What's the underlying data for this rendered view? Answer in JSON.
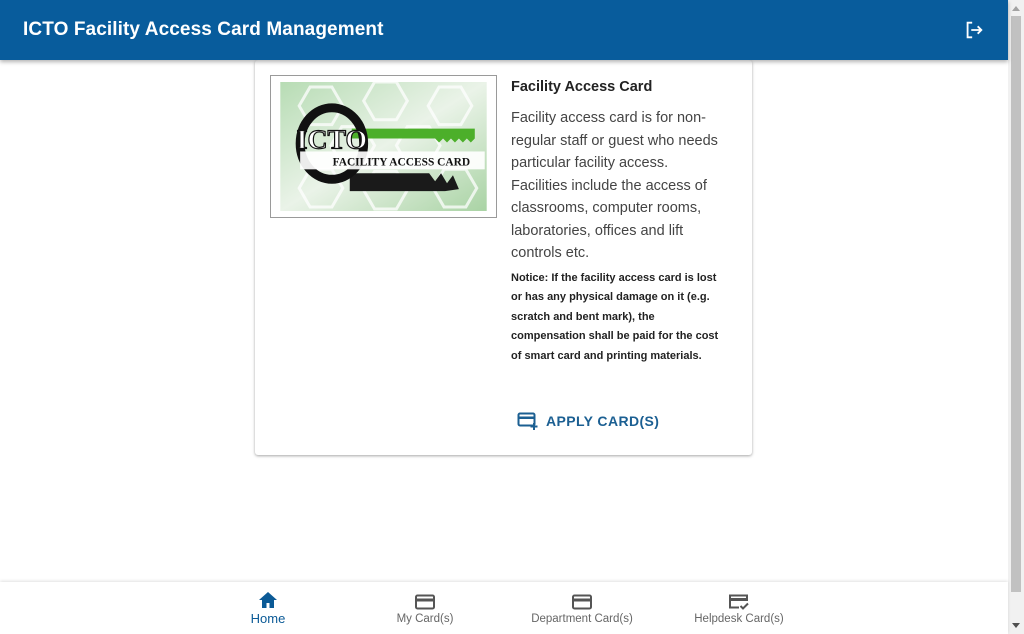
{
  "app": {
    "title": "ICTO Facility Access Card Management",
    "logout_icon": "logout-icon",
    "brand_color": "#085c9c"
  },
  "card": {
    "image": {
      "logo_text": "ICTO",
      "caption": "FACILITY ACCESS CARD"
    },
    "title": "Facility Access Card",
    "description": "Facility access card is for non-regular staff or guest who needs particular facility access. Facilities include the access of classrooms, computer rooms, laboratories, offices and lift controls etc.",
    "notice": "Notice: If the facility access card is lost or has any physical damage on it (e.g. scratch and bent mark), the compensation shall be paid for the cost of smart card and printing materials.",
    "apply_button": {
      "label": "APPLY CARD(S)",
      "icon": "add-card-icon"
    }
  },
  "bottom_nav": {
    "active_color": "#0b5a96",
    "items": [
      {
        "label": "Home",
        "icon": "home-icon",
        "active": true
      },
      {
        "label": "My Card(s)",
        "icon": "credit-card-icon",
        "active": false
      },
      {
        "label": "Department Card(s)",
        "icon": "credit-card-icon",
        "active": false
      },
      {
        "label": "Helpdesk Card(s)",
        "icon": "card-check-icon",
        "active": false
      }
    ]
  }
}
